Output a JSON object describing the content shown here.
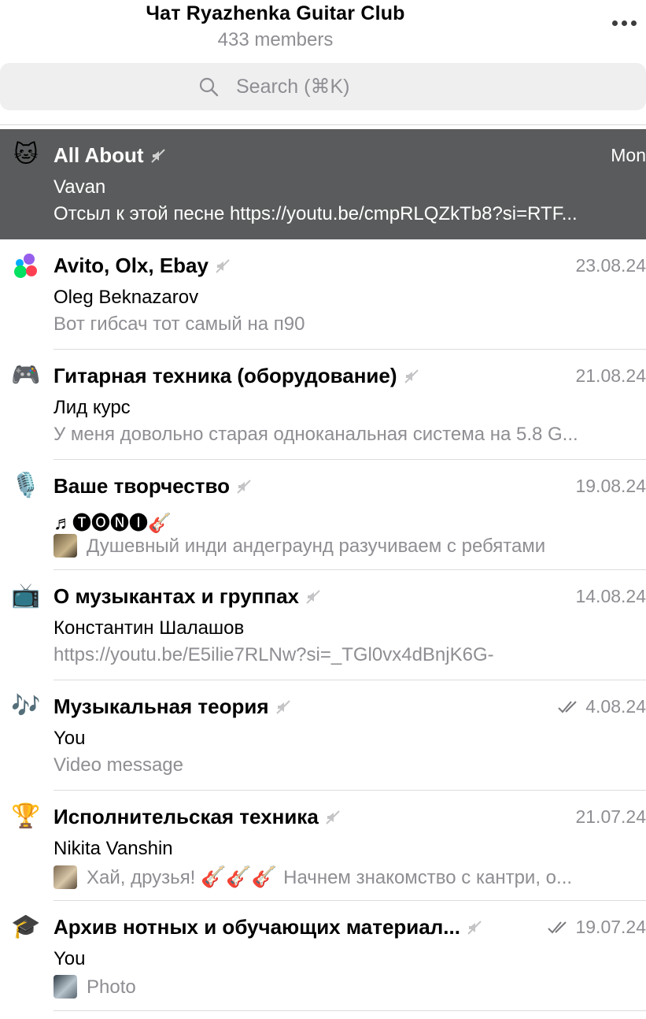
{
  "header": {
    "title": "Чат Ryazhenka Guitar Club",
    "subtitle": "433 members",
    "more_icon": "more-horizontal-icon"
  },
  "search": {
    "placeholder": "Search (⌘K)",
    "icon": "search-icon"
  },
  "topics": [
    {
      "icon": "🐱",
      "icon_name": "cat-face-icon",
      "title": "All About",
      "date": "Mon",
      "sender": "Vavan",
      "message": "Отсыл к этой песне https://youtu.be/cmpRLQZkTb8?si=RTF...",
      "active": true,
      "muted": true
    },
    {
      "icon": "🟣",
      "icon_name": "avito-dots-icon",
      "title": "Avito, Olx, Ebay",
      "date": "23.08.24",
      "sender": "Oleg Beknazarov",
      "message": "Вот гибсач тот самый на п90",
      "muted": true
    },
    {
      "icon": "🎮",
      "icon_name": "gamepad-icon",
      "title": "Гитарная техника (оборудование)",
      "date": "21.08.24",
      "sender": "Лид курс",
      "message": "У меня довольно старая одноканальная система на 5.8 G...",
      "muted": true
    },
    {
      "icon": "🎙️",
      "icon_name": "microphone-icon",
      "title": "Ваше творчество",
      "date": "19.08.24",
      "sender": "♬🅣🅞🅝🅘🎸",
      "message": "Душевный инди андеграунд разучиваем с ребятами",
      "thumb": "t1",
      "muted": true
    },
    {
      "icon": "📺",
      "icon_name": "television-icon",
      "title": "О музыкантах и группах",
      "date": "14.08.24",
      "sender": "Константин Шалашов",
      "message": "https://youtu.be/E5ilie7RLNw?si=_TGl0vx4dBnjK6G-",
      "muted": true
    },
    {
      "icon": "🎶",
      "icon_name": "music-notes-icon",
      "title": "Музыкальная теория",
      "date": "4.08.24",
      "sender": "You",
      "message": "Video message",
      "read": true,
      "muted": true
    },
    {
      "icon": "🏆",
      "icon_name": "trophy-icon",
      "title": "Исполнительская техника",
      "date": "21.07.24",
      "sender": "Nikita Vanshin",
      "message_parts": [
        "Хай, друзья!",
        "🎸🎸🎸",
        "Начнем знакомство с кантри, о..."
      ],
      "thumb": "t2",
      "muted": true
    },
    {
      "icon": "🎓",
      "icon_name": "graduation-cap-icon",
      "title": "Архив нотных и обучающих материал...",
      "date": "19.07.24",
      "sender": "You",
      "message": "Photo",
      "thumb": "t3",
      "read": true,
      "muted": true
    }
  ],
  "colors": {
    "active_bg": "#5a5b5c",
    "secondary_text": "#8e8e93",
    "search_bg": "#efeff0"
  }
}
